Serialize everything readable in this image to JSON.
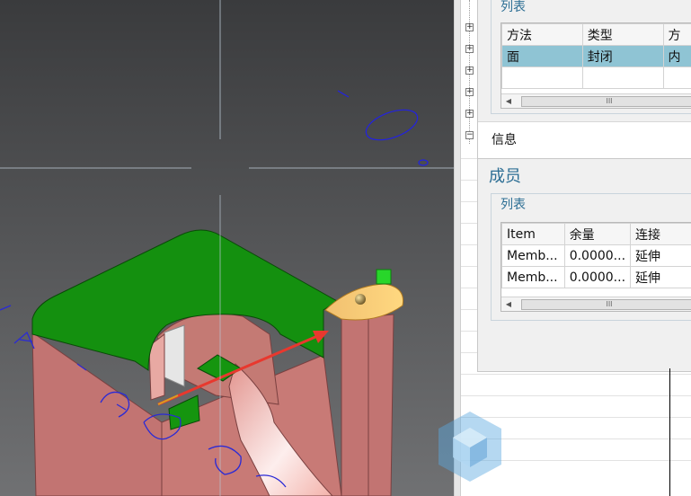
{
  "list_panel": {
    "group_title": "列表",
    "columns": [
      "方法",
      "类型",
      "方"
    ],
    "rows": [
      [
        "面",
        "封闭",
        "内"
      ]
    ]
  },
  "info_label": "信息",
  "members_section": {
    "title": "成员",
    "list_title": "列表",
    "columns": [
      "Item",
      "余量",
      "连接"
    ],
    "rows": [
      [
        "Memb...",
        "0.0000...",
        "延伸"
      ],
      [
        "Memb...",
        "0.0000...",
        "延伸"
      ]
    ]
  },
  "scrollbar_glyph": "III",
  "colors": {
    "viewport_bg_top": "#3b3c3e",
    "viewport_bg_bottom": "#6c6d6f",
    "green_face": "#14900f",
    "pink_solid": "#c97770",
    "selection": "#8fc4d4",
    "section_title": "#2c6e94",
    "arrow": "#e8382e"
  },
  "watermark_icon": "cube-logo-icon"
}
